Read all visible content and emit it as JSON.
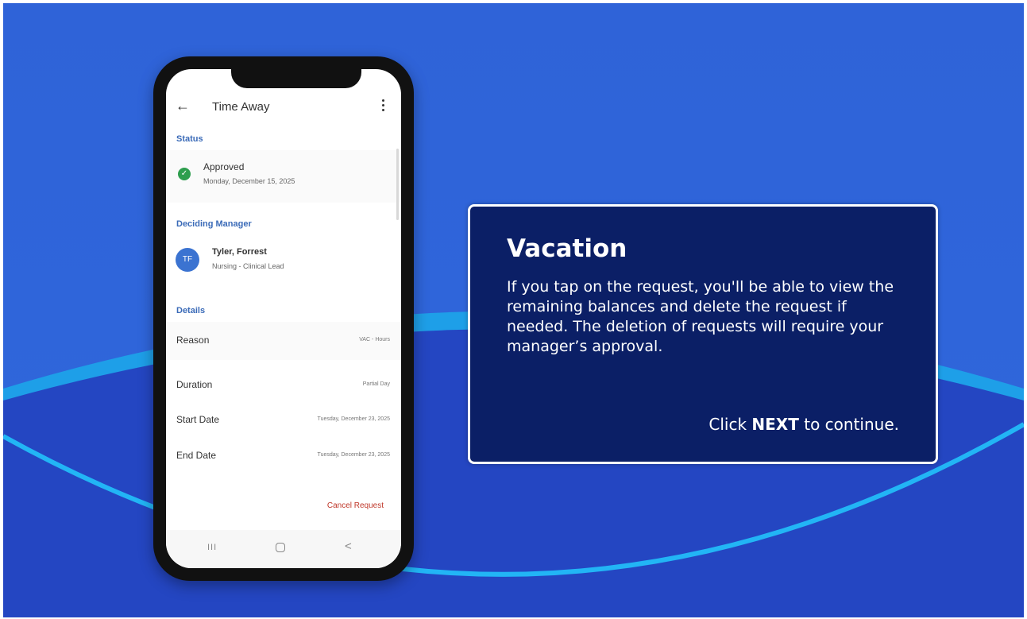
{
  "phone": {
    "app_title": "Time Away",
    "icons": {
      "back": "arrow-left-icon",
      "more": "more-vertical-icon",
      "check": "check-circle-icon"
    },
    "status_label": "Status",
    "status_value": "Approved",
    "status_date": "Monday, December 15, 2025",
    "manager_label": "Deciding Manager",
    "manager_initials": "TF",
    "manager_name": "Tyler, Forrest",
    "manager_role": "Nursing - Clinical Lead",
    "details_label": "Details",
    "details": [
      {
        "label": "Reason",
        "value": "VAC - Hours"
      },
      {
        "label": "Duration",
        "value": "Partial Day"
      },
      {
        "label": "Start Date",
        "value": "Tuesday, December 23, 2025"
      },
      {
        "label": "End Date",
        "value": "Tuesday, December 23, 2025"
      }
    ],
    "cancel_label": "Cancel Request",
    "nav": {
      "recent": "III",
      "home": "home-icon",
      "back": "<"
    }
  },
  "info": {
    "title": "Vacation",
    "body": "If you tap on the request, you'll be able to view the remaining balances and delete the request if needed. The deletion of requests will require your manager’s approval.",
    "cta_prefix": "Click ",
    "cta_bold": "NEXT",
    "cta_suffix": " to continue."
  },
  "colors": {
    "background": "#2f63d8",
    "arc_light": "#1ea3ec",
    "arc_dark": "#2245c0",
    "panel": "#0b1f66",
    "accent_blue": "#3b6bb8",
    "approved_green": "#2e9e4e",
    "cancel_red": "#c0392b"
  }
}
